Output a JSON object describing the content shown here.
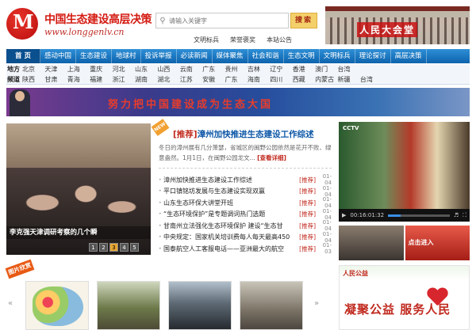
{
  "header": {
    "logo_glyph": "M",
    "site_title": "中国生态建设高层决策",
    "site_url": "www.longgenlv.cn",
    "search_placeholder": "请输入关键字",
    "search_button": "搜索",
    "quick_links": [
      "文明标兵",
      "荣誉褒奖",
      "本站公告"
    ],
    "banner_text": "人民大会堂"
  },
  "nav": {
    "items": [
      "首 页",
      "感动中国",
      "生态建设",
      "地球村",
      "投诉举报",
      "必读新闻",
      "媒体聚焦",
      "社会和谐",
      "生态文明",
      "文明标兵",
      "理论探讨",
      "高层决策"
    ]
  },
  "regions": {
    "row1_label": "地方",
    "row1": [
      "北京",
      "天津",
      "上海",
      "重庆",
      "河北",
      "山东",
      "山西",
      "云南",
      "广东",
      "贵州",
      "吉林",
      "辽宁",
      "香港",
      "澳门",
      "台湾"
    ],
    "row2_label": "频道",
    "row2": [
      "陕西",
      "甘肃",
      "青海",
      "福建",
      "浙江",
      "湖南",
      "湖北",
      "江苏",
      "安徽",
      "广东",
      "海南",
      "四川",
      "西藏",
      "内蒙古",
      "新疆",
      "台湾"
    ]
  },
  "slogan": {
    "text": "努力把中国建设成为生态大国"
  },
  "slideshow": {
    "caption": "李克强天津调研考察的几个瞬",
    "pages": [
      "1",
      "2",
      "3",
      "4",
      "5"
    ],
    "current_page": 3
  },
  "headline": {
    "badge": "NEW",
    "prefix": "[推荐]",
    "title": "漳州加快推进生态建设工作综述",
    "lead": "冬日的漳州展有几分萧瑟，省城区的闽野公园依然是花开不败、绿意盎然。1月1日，在闽野公园龙文...",
    "more": "[查看详细]"
  },
  "news": [
    {
      "title": "漳州加快推进生态建设工作综述",
      "cat": "[推荐]",
      "date": "01-04"
    },
    {
      "title": "平口镇铭坊发展与生态建设实现双赢",
      "cat": "[推荐]",
      "date": "01-04"
    },
    {
      "title": "山东生态环保大讲堂开班",
      "cat": "[推荐]",
      "date": "01-04"
    },
    {
      "title": "“生态环境保护”是专题调词热门选题",
      "cat": "[推荐]",
      "date": "01-04"
    },
    {
      "title": "甘南州立法强化生态环境保护 建设“生态甘",
      "cat": "[推荐]",
      "date": "01-04"
    },
    {
      "title": "中央规定：国家机关培训费每人每天最高450",
      "cat": "[推荐]",
      "date": "01-04"
    },
    {
      "title": "国泰航空人工客服电话——亚洲最大的航空",
      "cat": "[推荐]",
      "date": "01-03"
    }
  ],
  "video": {
    "channel": "CCTV",
    "time": "00:16:01:32",
    "second_thumb_text": "点击进入"
  },
  "pictures": {
    "tag": "图片欣赏",
    "prev": "«",
    "next": "»"
  },
  "ad": {
    "header": "人民公益",
    "slogan": "凝聚公益 服务人民"
  }
}
